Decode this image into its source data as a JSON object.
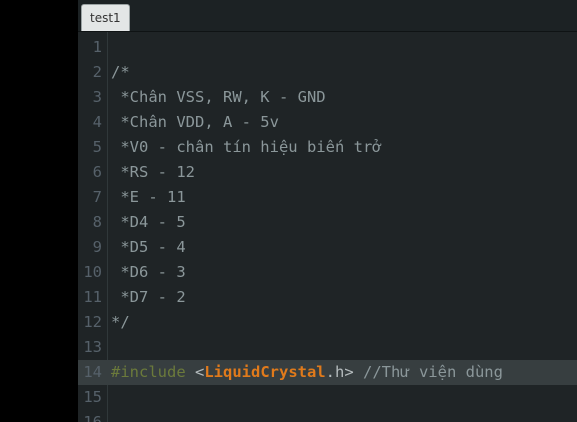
{
  "tab": {
    "label": "test1"
  },
  "lines": [
    {
      "n": "1",
      "text": ""
    },
    {
      "n": "2",
      "text": "/*"
    },
    {
      "n": "3",
      "text": " *Chân VSS, RW, K - GND"
    },
    {
      "n": "4",
      "text": " *Chân VDD, A - 5v"
    },
    {
      "n": "5",
      "text": " *V0 - chân tín hiệu biến trở"
    },
    {
      "n": "6",
      "text": " *RS - 12"
    },
    {
      "n": "7",
      "text": " *E - 11"
    },
    {
      "n": "8",
      "text": " *D4 - 5"
    },
    {
      "n": "9",
      "text": " *D5 - 4"
    },
    {
      "n": "10",
      "text": " *D6 - 3"
    },
    {
      "n": "11",
      "text": " *D7 - 2"
    },
    {
      "n": "12",
      "text": "*/"
    },
    {
      "n": "13",
      "text": ""
    },
    {
      "n": "14",
      "include": {
        "directive": "#include",
        "open": " <",
        "cls": "LiquidCrystal",
        "close": ".h>",
        "comment": " //Thư viện dùng"
      }
    },
    {
      "n": "15",
      "text": ""
    },
    {
      "n": "16",
      "text": ""
    }
  ]
}
